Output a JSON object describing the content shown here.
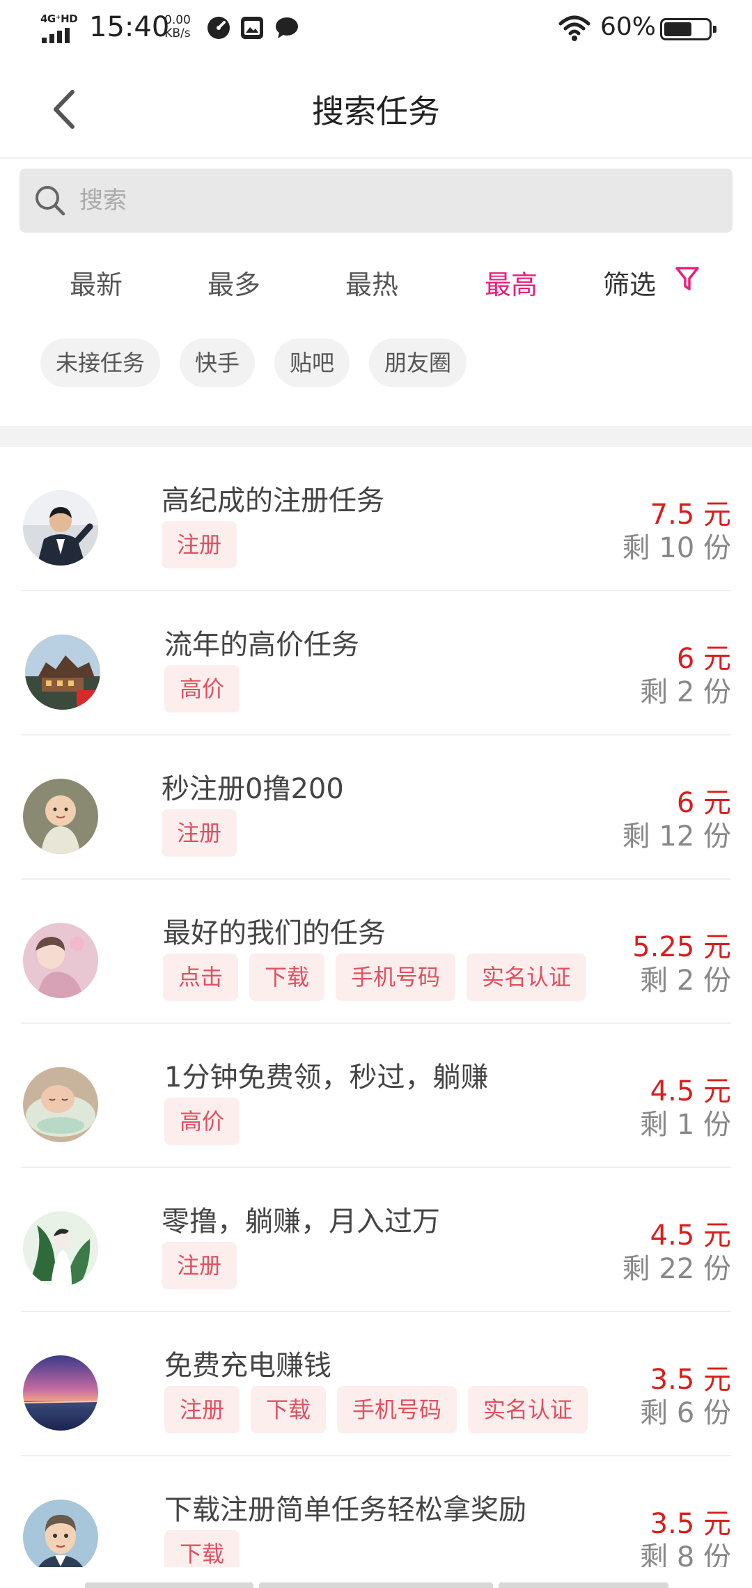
{
  "status_bar": {
    "network": "4G⁺HD",
    "time": "15:40",
    "speed_value": "0.00",
    "speed_unit": "KB/s",
    "battery_percent": "60%",
    "battery_level": 0.6
  },
  "header": {
    "title": "搜索任务"
  },
  "search": {
    "placeholder": "搜索",
    "value": ""
  },
  "sort_tabs": [
    {
      "label": "最新",
      "active": false
    },
    {
      "label": "最多",
      "active": false
    },
    {
      "label": "最热",
      "active": false
    },
    {
      "label": "最高",
      "active": true
    },
    {
      "label": "筛选",
      "active": false
    }
  ],
  "chips": [
    "未接任务",
    "快手",
    "贴吧",
    "朋友圈"
  ],
  "tasks": [
    {
      "name": "高纪成的注册任务",
      "tags": [
        "注册"
      ],
      "price": "7.5 元",
      "remaining": "剩 10 份",
      "avatar": "person-suit-avatar"
    },
    {
      "name": "流年的高价任务",
      "tags": [
        "高价"
      ],
      "price": "6 元",
      "remaining": "剩 2 份",
      "avatar": "building-avatar"
    },
    {
      "name": "秒注册0撸200",
      "tags": [
        "注册"
      ],
      "price": "6 元",
      "remaining": "剩 12 份",
      "avatar": "baby-avatar"
    },
    {
      "name": "最好的我们的任务",
      "tags": [
        "点击",
        "下载",
        "手机号码",
        "实名认证"
      ],
      "price": "5.25 元",
      "remaining": "剩 2 份",
      "avatar": "pink-portrait-avatar"
    },
    {
      "name": "1分钟免费领，秒过，躺赚",
      "tags": [
        "高价"
      ],
      "price": "4.5 元",
      "remaining": "剩 1 份",
      "avatar": "sleeping-baby-avatar"
    },
    {
      "name": "零撸，躺赚，月入过万",
      "tags": [
        "注册"
      ],
      "price": "4.5 元",
      "remaining": "剩 22 份",
      "avatar": "green-art-avatar"
    },
    {
      "name": "免费充电赚钱",
      "tags": [
        "注册",
        "下载",
        "手机号码",
        "实名认证"
      ],
      "price": "3.5 元",
      "remaining": "剩 6 份",
      "avatar": "sunset-avatar"
    },
    {
      "name": "下载注册简单任务轻松拿奖励",
      "tags": [
        "下载"
      ],
      "price": "3.5 元",
      "remaining": "剩 8 份",
      "avatar": "cartoon-man-avatar"
    }
  ],
  "colors": {
    "accent_pink": "#e8207a",
    "price_red": "#d81e1e",
    "tag_text": "#e05060",
    "tag_bg": "#fdeeee"
  }
}
